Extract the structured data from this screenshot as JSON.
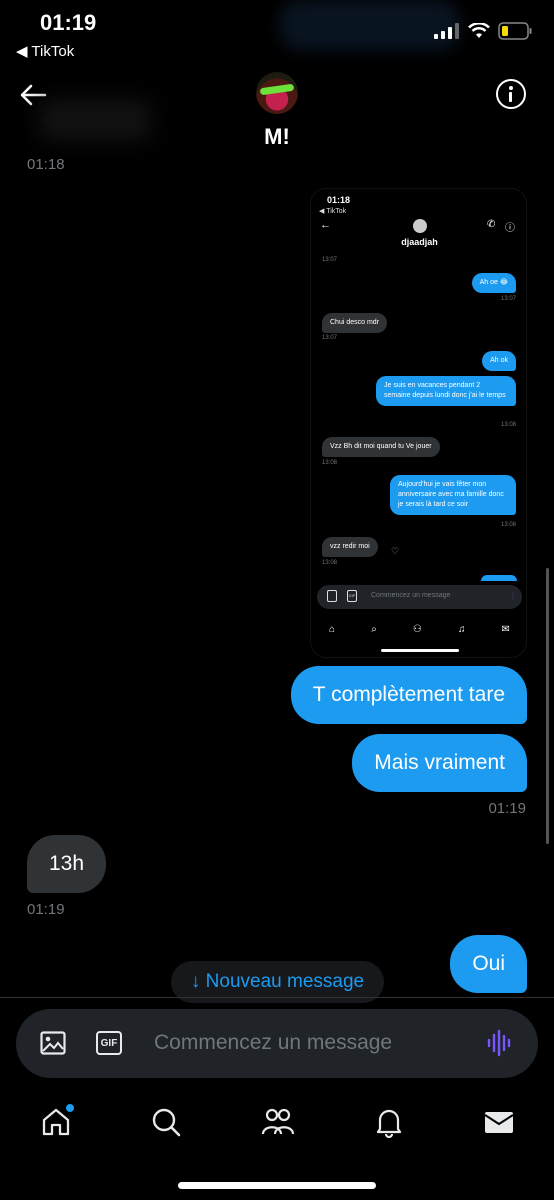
{
  "status": {
    "time": "01:19",
    "back_app": "◀ TikTok"
  },
  "header": {
    "name": "M!"
  },
  "chat": {
    "top_time": "01:18",
    "shot": {
      "time": "01:18",
      "app": "◀ TikTok",
      "name": "djaadjah",
      "messages": [
        {
          "ts": "13:07"
        },
        {
          "text": "Ah oe 😂",
          "ts": "13:07"
        },
        {
          "text": "Chui desco mdr",
          "ts": "13:07"
        },
        {
          "text": "Ah ok"
        },
        {
          "text": "Je suis en vacances pendant 2 semaine depuis lundi donc j'ai le temps",
          "ts": "13:08"
        },
        {
          "text": "Vzz Bh dit moi quand tu Ve jouer",
          "ts": "13:08"
        },
        {
          "text": "Aujourd'hui je vais fêter mon anniversaire avec ma famille donc je serais là tard ce soir",
          "ts": "13:08"
        },
        {
          "text": "vzz redir moi",
          "ts": "13:08"
        }
      ],
      "composer_placeholder": "Commencez un message"
    },
    "msg1": "T complètement tare",
    "msg2": "Mais vraiment",
    "ts_out": "01:19",
    "msg_in": "13h",
    "ts_in": "01:19",
    "msg_oui": "Oui"
  },
  "new_message": "↓ Nouveau message",
  "composer": {
    "placeholder": "Commencez un message"
  },
  "colors": {
    "accent": "#1d9bf0",
    "incoming": "#2f3336",
    "voice": "#7856ff"
  }
}
